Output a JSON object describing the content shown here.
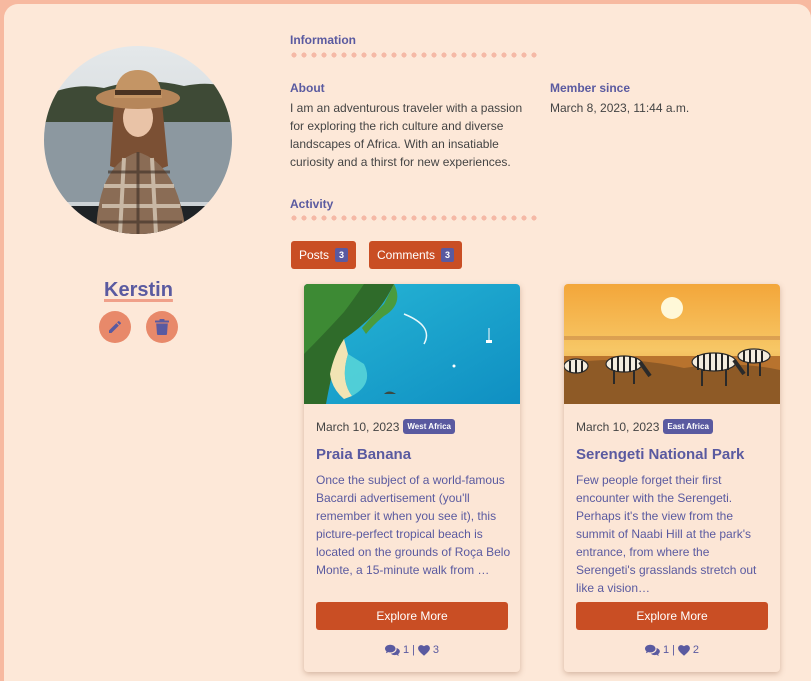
{
  "profile": {
    "username": "Kerstin",
    "avatar_desc": "woman-in-hat-portrait"
  },
  "info": {
    "information_label": "Information",
    "about_label": "About",
    "about_text": "I am an adventurous traveler with a passion for exploring the rich culture and diverse landscapes of Africa. With an insatiable curiosity and a thirst for new experiences.",
    "member_since_label": "Member since",
    "member_since_value": "March 8, 2023, 11:44 a.m.",
    "activity_label": "Activity"
  },
  "tabs": {
    "posts_label": "Posts",
    "posts_count": "3",
    "comments_label": "Comments",
    "comments_count": "3"
  },
  "cards": [
    {
      "date": "March 10, 2023",
      "tag": "West Africa",
      "title": "Praia Banana",
      "description": "Once the subject of a world-famous Bacardi advertisement (you'll remember it when you see it), this picture-perfect tropical beach is located on the grounds of Roça Belo Monte, a 15-minute walk from …",
      "button": "Explore More",
      "comments": "1",
      "separator": "|",
      "likes": "3"
    },
    {
      "date": "March 10, 2023",
      "tag": "East Africa",
      "title": "Serengeti National Park",
      "description": "Few people forget their first encounter with the Serengeti. Perhaps it's the view from the summit of Naabi Hill at the park's entrance, from where the Serengeti's grasslands stretch out like a vision…",
      "button": "Explore More",
      "comments": "1",
      "separator": "|",
      "likes": "2"
    }
  ],
  "colors": {
    "accent": "#c94e24",
    "primary_text": "#5a5aa0",
    "background": "#fde8d8",
    "icon_button": "#e8896a"
  },
  "icons": {
    "edit": "pencil-icon",
    "delete": "trash-icon",
    "comments": "comments-icon",
    "likes": "heart-icon"
  }
}
